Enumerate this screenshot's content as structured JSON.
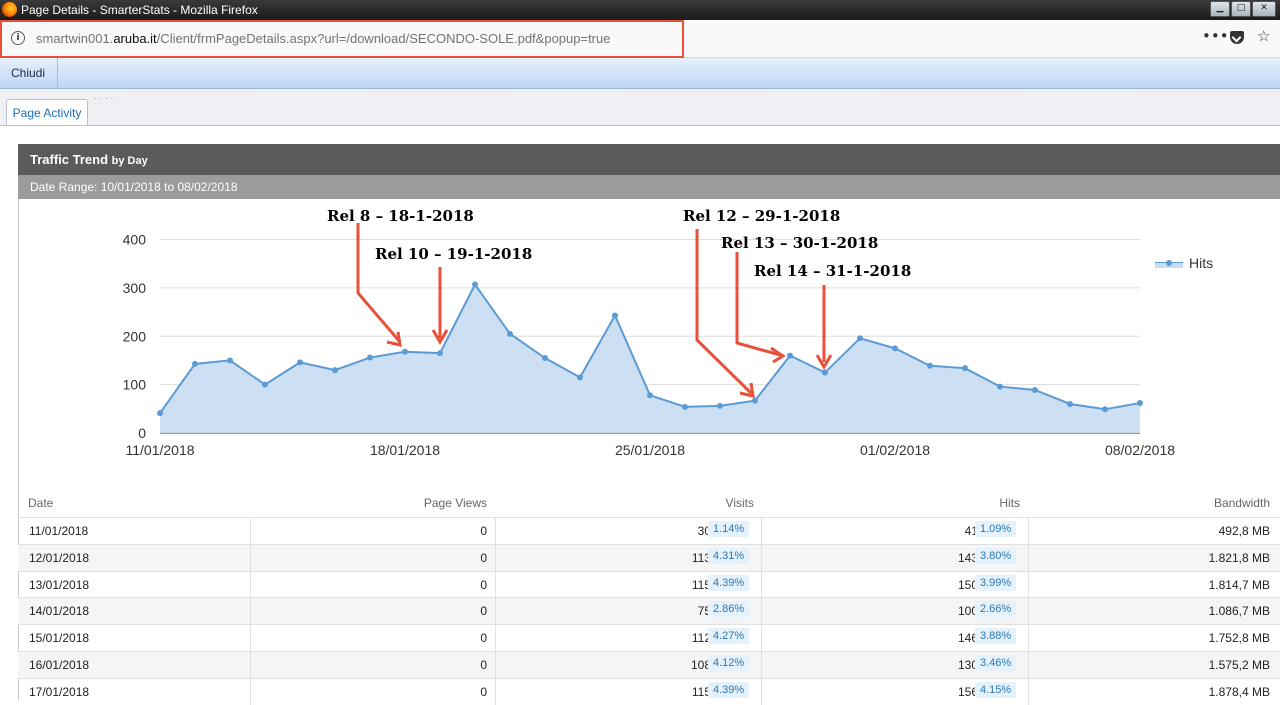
{
  "window": {
    "title": "Page Details - SmarterStats - Mozilla Firefox"
  },
  "address_bar": {
    "url_prefix": "smartwin001.",
    "url_domain": "aruba.it",
    "url_path": "/Client/frmPageDetails.aspx?url=/download/SECONDO-SOLE.pdf&popup=true"
  },
  "toolbar": {
    "close_label": "Chiudi"
  },
  "tabs": [
    {
      "label": "Page Activity"
    }
  ],
  "panel": {
    "title": "Traffic Trend",
    "title_suffix": "by Day",
    "date_range": "Date Range:  10/01/2018 to 08/02/2018"
  },
  "colors": {
    "series": "#5b9bd5",
    "area": "#c8dcf2",
    "annotation_arrow": "#e8503a",
    "highlight": "#e8503a"
  },
  "annotations": [
    {
      "label": "Rel 8 – 18-1-2018"
    },
    {
      "label": "Rel 10 – 19-1-2018"
    },
    {
      "label": "Rel 12 – 29-1-2018"
    },
    {
      "label": "Rel 13 – 30-1-2018"
    },
    {
      "label": "Rel 14 – 31-1-2018"
    }
  ],
  "chart_data": {
    "type": "area",
    "x": [
      "11/01/2018",
      "12/01/2018",
      "13/01/2018",
      "14/01/2018",
      "15/01/2018",
      "16/01/2018",
      "17/01/2018",
      "18/01/2018",
      "19/01/2018",
      "20/01/2018",
      "21/01/2018",
      "22/01/2018",
      "23/01/2018",
      "24/01/2018",
      "25/01/2018",
      "26/01/2018",
      "27/01/2018",
      "28/01/2018",
      "29/01/2018",
      "30/01/2018",
      "31/01/2018",
      "01/02/2018",
      "02/02/2018",
      "03/02/2018",
      "04/02/2018",
      "05/02/2018",
      "06/02/2018",
      "07/02/2018",
      "08/02/2018"
    ],
    "x_tick_labels": [
      "11/01/2018",
      "18/01/2018",
      "25/01/2018",
      "01/02/2018",
      "08/02/2018"
    ],
    "series": [
      {
        "name": "Hits",
        "values": [
          41,
          143,
          150,
          100,
          146,
          130,
          156,
          168,
          165,
          307,
          205,
          155,
          115,
          243,
          78,
          54,
          56,
          67,
          160,
          125,
          196,
          175,
          139,
          134,
          96,
          89,
          60,
          49,
          62
        ]
      }
    ],
    "yticks": [
      0,
      100,
      200,
      300,
      400
    ],
    "ylim": [
      0,
      430
    ],
    "legend": "top-right",
    "grid": true
  },
  "table": {
    "headers": [
      "Date",
      "Page Views",
      "Visits",
      "Hits",
      "Bandwidth"
    ],
    "rows": [
      {
        "date": "11/01/2018",
        "page_views": "0",
        "visits": "30",
        "visits_pct": "1.14%",
        "hits": "41",
        "hits_pct": "1.09%",
        "bandwidth": "492,8 MB"
      },
      {
        "date": "12/01/2018",
        "page_views": "0",
        "visits": "113",
        "visits_pct": "4.31%",
        "hits": "143",
        "hits_pct": "3.80%",
        "bandwidth": "1.821,8 MB"
      },
      {
        "date": "13/01/2018",
        "page_views": "0",
        "visits": "115",
        "visits_pct": "4.39%",
        "hits": "150",
        "hits_pct": "3.99%",
        "bandwidth": "1.814,7 MB"
      },
      {
        "date": "14/01/2018",
        "page_views": "0",
        "visits": "75",
        "visits_pct": "2.86%",
        "hits": "100",
        "hits_pct": "2.66%",
        "bandwidth": "1.086,7 MB"
      },
      {
        "date": "15/01/2018",
        "page_views": "0",
        "visits": "112",
        "visits_pct": "4.27%",
        "hits": "146",
        "hits_pct": "3.88%",
        "bandwidth": "1.752,8 MB"
      },
      {
        "date": "16/01/2018",
        "page_views": "0",
        "visits": "108",
        "visits_pct": "4.12%",
        "hits": "130",
        "hits_pct": "3.46%",
        "bandwidth": "1.575,2 MB"
      },
      {
        "date": "17/01/2018",
        "page_views": "0",
        "visits": "115",
        "visits_pct": "4.39%",
        "hits": "156",
        "hits_pct": "4.15%",
        "bandwidth": "1.878,4 MB"
      }
    ]
  }
}
